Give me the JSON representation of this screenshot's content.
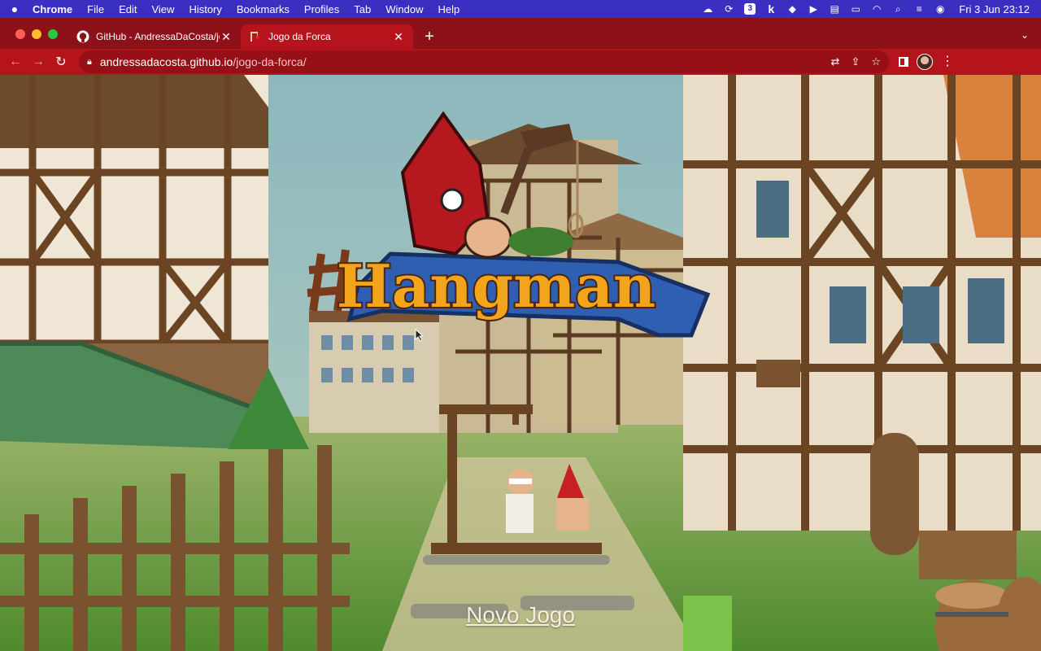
{
  "menubar": {
    "app_name": "Chrome",
    "items": [
      "File",
      "Edit",
      "View",
      "History",
      "Bookmarks",
      "Profiles",
      "Tab",
      "Window",
      "Help"
    ],
    "status_badge": "3",
    "status_k": "k",
    "clock": "Fri 3 Jun  23:12"
  },
  "tabs": [
    {
      "title": "GitHub - AndressaDaCosta/jogo",
      "active": false,
      "favicon": "github-icon"
    },
    {
      "title": "Jogo da Forca",
      "active": true,
      "favicon": "hangman-favicon"
    }
  ],
  "address_bar": {
    "host": "andressadacosta.github.io",
    "path": "/jogo-da-forca/"
  },
  "page": {
    "logo_text": "Hangman",
    "new_game_label": "Novo Jogo"
  },
  "colors": {
    "menubar": "#3a2fc0",
    "tabstrip": "#8c1119",
    "toolbar": "#b5141c",
    "logo_text": "#f2a41c",
    "banner": "#2f5fb0"
  }
}
